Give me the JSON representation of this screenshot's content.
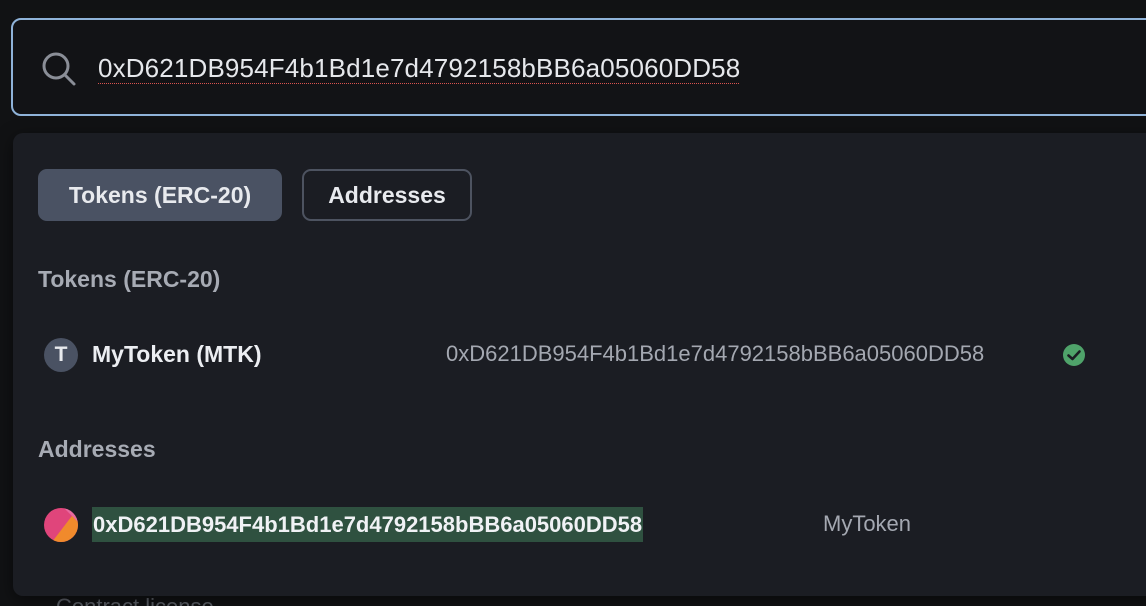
{
  "search": {
    "value": "0xD621DB954F4b1Bd1e7d4792158bBB6a05060DD58"
  },
  "behind": {
    "text": "Contract license"
  },
  "dropdown": {
    "tabs": [
      {
        "label": "Tokens (ERC-20)",
        "active": true
      },
      {
        "label": "Addresses",
        "active": false
      }
    ],
    "tokens_section": {
      "title": "Tokens (ERC-20)",
      "items": [
        {
          "avatar_letter": "T",
          "name": "MyToken (MTK)",
          "address": "0xD621DB954F4b1Bd1e7d4792158bBB6a05060DD58",
          "verified": true,
          "verified_icon": "check-circle-icon"
        }
      ]
    },
    "addresses_section": {
      "title": "Addresses",
      "items": [
        {
          "avatar_icon": "identicon-icon",
          "address": "0xD621DB954F4b1Bd1e7d4792158bBB6a05060DD58",
          "label": "MyToken"
        }
      ]
    }
  },
  "colors": {
    "background": "#111214",
    "panel": "#1b1d23",
    "search_border": "#8fb3d9",
    "active_tab": "#4a5263",
    "highlight": "#2f5140",
    "verified": "#4fa36a",
    "identicon_pink": "#e0457b",
    "identicon_orange": "#f08a2c"
  }
}
